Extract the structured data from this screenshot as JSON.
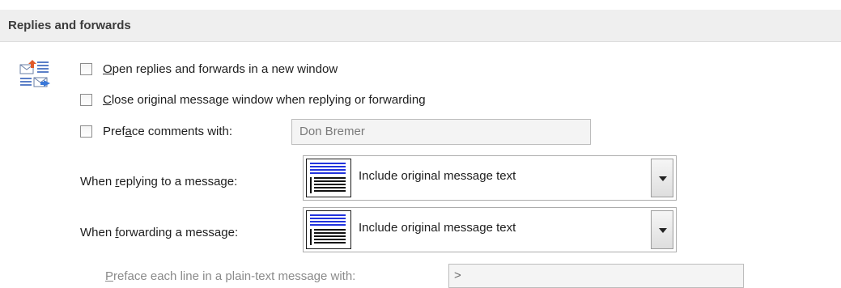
{
  "section": {
    "title": "Replies and forwards"
  },
  "options": {
    "open_new_window": {
      "checked": false,
      "mnemonic": "O",
      "rest": "pen replies and forwards in a new window"
    },
    "close_original": {
      "checked": false,
      "mnemonic": "C",
      "rest": "lose original message window when replying or forwarding"
    },
    "preface_comments": {
      "checked": false,
      "before": "Pref",
      "mnemonic": "a",
      "after": "ce comments with:",
      "value": "Don Bremer"
    }
  },
  "replying": {
    "label_before": "When ",
    "mnemonic": "r",
    "label_after": "eplying to a message:",
    "selected": "Include original message text"
  },
  "forwarding": {
    "label_before": "When ",
    "mnemonic": "f",
    "label_after": "orwarding a message:",
    "selected": "Include original message text"
  },
  "preface_line": {
    "mnemonic": "P",
    "rest": "reface each line in a plain-text message with:",
    "value": ">"
  },
  "icons": {
    "section": "reply-forward-icon",
    "combo_thumbnail": "message-layout-icon",
    "dropdown_arrow": "chevron-down-icon"
  },
  "colors": {
    "header_background": "#efefef",
    "thumbnail_accent": "#2233dd"
  }
}
